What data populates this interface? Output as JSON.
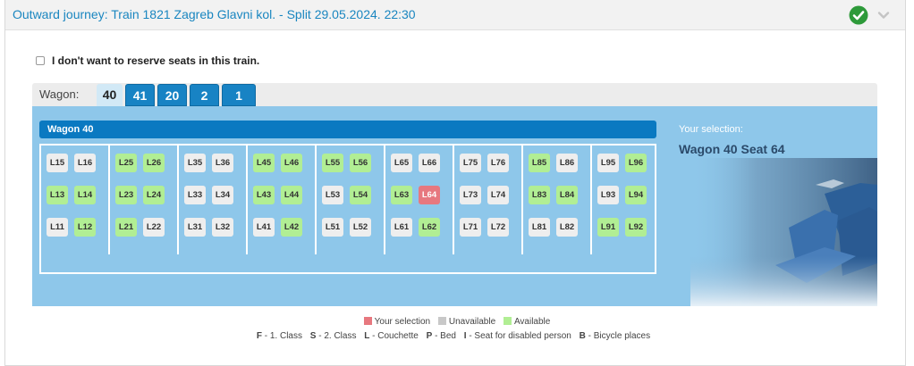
{
  "header": {
    "title": "Outward journey: Train 1821 Zagreb Glavni kol. - Split 29.05.2024. 22:30",
    "status_icon": "check-circle-icon",
    "toggle_icon": "chevron-down-icon",
    "status_color": "#2e9a3a"
  },
  "optout": {
    "label": "I don't want to reserve seats in this train.",
    "checked": false
  },
  "tabs": {
    "label": "Wagon:",
    "items": [
      {
        "label": "40",
        "active": true
      },
      {
        "label": "41",
        "active": false
      },
      {
        "label": "20",
        "active": false
      },
      {
        "label": "2",
        "active": false
      },
      {
        "label": "1",
        "active": false
      }
    ]
  },
  "wagon": {
    "title": "Wagon 40",
    "compartments": [
      {
        "rows": [
          [
            {
              "label": "L15",
              "state": "unavailable"
            },
            {
              "label": "L16",
              "state": "unavailable"
            }
          ],
          [
            {
              "label": "L13",
              "state": "available"
            },
            {
              "label": "L14",
              "state": "available"
            }
          ],
          [
            {
              "label": "L11",
              "state": "unavailable"
            },
            {
              "label": "L12",
              "state": "available"
            }
          ]
        ]
      },
      {
        "rows": [
          [
            {
              "label": "L25",
              "state": "available"
            },
            {
              "label": "L26",
              "state": "available"
            }
          ],
          [
            {
              "label": "L23",
              "state": "available"
            },
            {
              "label": "L24",
              "state": "available"
            }
          ],
          [
            {
              "label": "L21",
              "state": "available"
            },
            {
              "label": "L22",
              "state": "unavailable"
            }
          ]
        ]
      },
      {
        "rows": [
          [
            {
              "label": "L35",
              "state": "unavailable"
            },
            {
              "label": "L36",
              "state": "unavailable"
            }
          ],
          [
            {
              "label": "L33",
              "state": "unavailable"
            },
            {
              "label": "L34",
              "state": "unavailable"
            }
          ],
          [
            {
              "label": "L31",
              "state": "unavailable"
            },
            {
              "label": "L32",
              "state": "unavailable"
            }
          ]
        ]
      },
      {
        "rows": [
          [
            {
              "label": "L45",
              "state": "available"
            },
            {
              "label": "L46",
              "state": "available"
            }
          ],
          [
            {
              "label": "L43",
              "state": "available"
            },
            {
              "label": "L44",
              "state": "available"
            }
          ],
          [
            {
              "label": "L41",
              "state": "unavailable"
            },
            {
              "label": "L42",
              "state": "available"
            }
          ]
        ]
      },
      {
        "rows": [
          [
            {
              "label": "L55",
              "state": "available"
            },
            {
              "label": "L56",
              "state": "available"
            }
          ],
          [
            {
              "label": "L53",
              "state": "unavailable"
            },
            {
              "label": "L54",
              "state": "available"
            }
          ],
          [
            {
              "label": "L51",
              "state": "unavailable"
            },
            {
              "label": "L52",
              "state": "unavailable"
            }
          ]
        ]
      },
      {
        "rows": [
          [
            {
              "label": "L65",
              "state": "unavailable"
            },
            {
              "label": "L66",
              "state": "unavailable"
            }
          ],
          [
            {
              "label": "L63",
              "state": "available"
            },
            {
              "label": "L64",
              "state": "selected"
            }
          ],
          [
            {
              "label": "L61",
              "state": "unavailable"
            },
            {
              "label": "L62",
              "state": "available"
            }
          ]
        ]
      },
      {
        "rows": [
          [
            {
              "label": "L75",
              "state": "unavailable"
            },
            {
              "label": "L76",
              "state": "unavailable"
            }
          ],
          [
            {
              "label": "L73",
              "state": "unavailable"
            },
            {
              "label": "L74",
              "state": "unavailable"
            }
          ],
          [
            {
              "label": "L71",
              "state": "unavailable"
            },
            {
              "label": "L72",
              "state": "unavailable"
            }
          ]
        ]
      },
      {
        "rows": [
          [
            {
              "label": "L85",
              "state": "available"
            },
            {
              "label": "L86",
              "state": "unavailable"
            }
          ],
          [
            {
              "label": "L83",
              "state": "available"
            },
            {
              "label": "L84",
              "state": "available"
            }
          ],
          [
            {
              "label": "L81",
              "state": "unavailable"
            },
            {
              "label": "L82",
              "state": "unavailable"
            }
          ]
        ]
      },
      {
        "rows": [
          [
            {
              "label": "L95",
              "state": "unavailable"
            },
            {
              "label": "L96",
              "state": "available"
            }
          ],
          [
            {
              "label": "L93",
              "state": "unavailable"
            },
            {
              "label": "L94",
              "state": "available"
            }
          ],
          [
            {
              "label": "L91",
              "state": "available"
            },
            {
              "label": "L92",
              "state": "available"
            }
          ]
        ]
      }
    ]
  },
  "selection": {
    "title": "Your selection:",
    "value": "Wagon 40 Seat 64"
  },
  "legend": {
    "items": [
      {
        "label": "Your selection",
        "color": "#e7787f"
      },
      {
        "label": "Unavailable",
        "color": "#c8c8c8"
      },
      {
        "label": "Available",
        "color": "#b1ee94"
      }
    ],
    "classes": [
      {
        "code": "F",
        "text": " - 1. Class"
      },
      {
        "code": "S",
        "text": " - 2. Class"
      },
      {
        "code": "L",
        "text": " - Couchette"
      },
      {
        "code": "P",
        "text": " - Bed"
      },
      {
        "code": "I",
        "text": " - Seat for disabled person"
      },
      {
        "code": "B",
        "text": " - Bicycle places"
      }
    ]
  },
  "colors": {
    "accent": "#1883c4",
    "panel": "#8ec7ea",
    "wagon_bar": "#0a79c1"
  }
}
